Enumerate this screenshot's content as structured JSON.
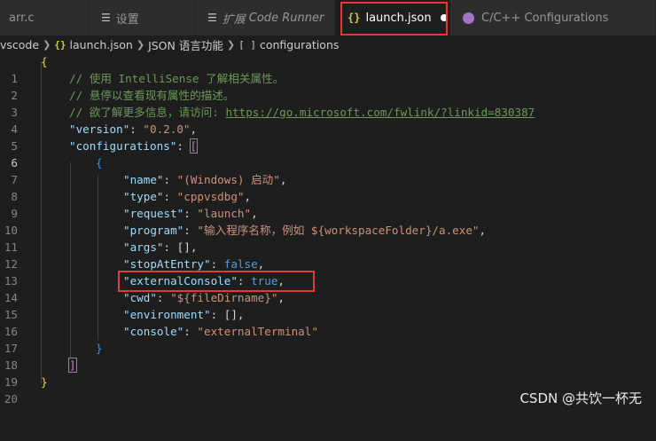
{
  "tabs": [
    {
      "label": "arr.c"
    },
    {
      "label": "设置"
    },
    {
      "label_prefix": "扩展",
      "label": "Code Runner"
    },
    {
      "label": "launch.json"
    },
    {
      "label": "C/C++ Configurations"
    }
  ],
  "breadcrumb": {
    "items": [
      "vscode",
      "launch.json",
      "JSON 语言功能",
      "configurations"
    ]
  },
  "editor": {
    "line_numbers": [
      "1",
      "2",
      "3",
      "4",
      "5",
      "6",
      "7",
      "8",
      "9",
      "10",
      "11",
      "12",
      "13",
      "14",
      "15",
      "16",
      "17",
      "18",
      "19",
      "20"
    ],
    "comments": {
      "c1": "// 使用 IntelliSense 了解相关属性。",
      "c2": "// 悬停以查看现有属性的描述。",
      "c3_prefix": "// 欲了解更多信息，请访问: ",
      "c3_link": "https://go.microsoft.com/fwlink/?linkid=830387"
    },
    "keys": {
      "version": "\"version\"",
      "configurations": "\"configurations\"",
      "name": "\"name\"",
      "type": "\"type\"",
      "request": "\"request\"",
      "program": "\"program\"",
      "args": "\"args\"",
      "stopAtEntry": "\"stopAtEntry\"",
      "externalConsole": "\"externalConsole\"",
      "cwd": "\"cwd\"",
      "environment": "\"environment\"",
      "console": "\"console\""
    },
    "values": {
      "version": "\"0.2.0\"",
      "name": "\"(Windows) 启动\"",
      "type": "\"cppvsdbg\"",
      "request": "\"launch\"",
      "program": "\"输入程序名称，例如 ${workspaceFolder}/a.exe\"",
      "args": "[]",
      "stopAtEntry": "false",
      "externalConsole": "true",
      "cwd": "\"${fileDirname}\"",
      "environment": "[]",
      "console": "\"externalTerminal\""
    }
  },
  "watermark": "CSDN @共饮一杯无",
  "colors": {
    "background": "#1e1e1e",
    "highlight_box": "#e53935",
    "string": "#ce9178",
    "key": "#9cdcfe",
    "comment": "#6a9955",
    "boolean": "#569cd6"
  }
}
